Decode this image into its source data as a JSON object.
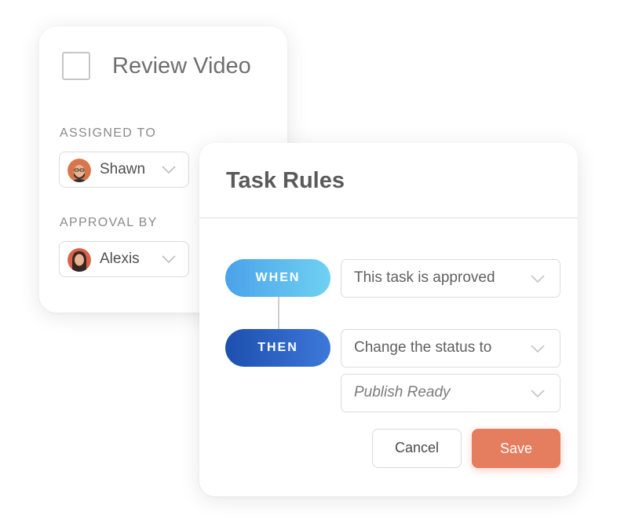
{
  "task": {
    "title": "Review Video",
    "assigned_label": "ASSIGNED TO",
    "assigned_name": "Shawn",
    "approval_label": "APPROVAL BY",
    "approval_name": "Alexis"
  },
  "rules": {
    "title": "Task Rules",
    "when_label": "WHEN",
    "then_label": "THEN",
    "when_value": "This task is approved",
    "then_value": "Change the status to",
    "status_value": "Publish Ready",
    "cancel_label": "Cancel",
    "save_label": "Save"
  },
  "icons": {
    "dropdown": "chevron-down-icon",
    "checkbox": "checkbox-icon",
    "avatar": "avatar"
  },
  "colors": {
    "save_button": "#e57d5f",
    "when_pill_start": "#4aa2e9",
    "when_pill_end": "#6fd1f2",
    "then_pill_start": "#1d4fae",
    "then_pill_end": "#3d78d9"
  }
}
